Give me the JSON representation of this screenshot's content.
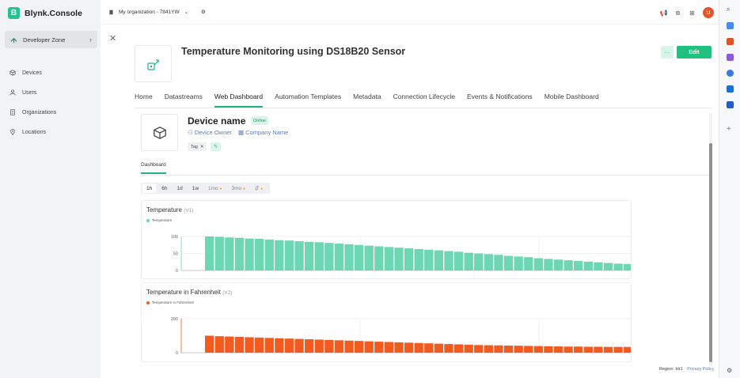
{
  "brand": {
    "name": "Blynk.Console",
    "logo_letter": "B"
  },
  "sidebar": {
    "developer_zone": "Developer Zone",
    "items": [
      {
        "label": "Devices",
        "icon": "cube-icon"
      },
      {
        "label": "Users",
        "icon": "users-icon"
      },
      {
        "label": "Organizations",
        "icon": "building-icon"
      },
      {
        "label": "Locations",
        "icon": "pin-icon"
      }
    ]
  },
  "topbar": {
    "organization": "My organization - 7841YW",
    "avatar_initial": "U"
  },
  "template": {
    "title": "Temperature Monitoring using DS18B20 Sensor",
    "more_label": "···",
    "edit_label": "Edit"
  },
  "tabs": [
    {
      "label": "Home"
    },
    {
      "label": "Datastreams"
    },
    {
      "label": "Web Dashboard",
      "active": true
    },
    {
      "label": "Automation Templates"
    },
    {
      "label": "Metadata"
    },
    {
      "label": "Connection Lifecycle"
    },
    {
      "label": "Events & Notifications"
    },
    {
      "label": "Mobile Dashboard"
    }
  ],
  "device": {
    "name": "Device name",
    "status": "Online",
    "owner": "Device Owner",
    "company": "Company Name",
    "tag": "Tag"
  },
  "dashboard_tab": "Dashboard",
  "time_ranges": [
    {
      "label": "1h",
      "active": true
    },
    {
      "label": "6h"
    },
    {
      "label": "1d"
    },
    {
      "label": "1w"
    },
    {
      "label": "1mo",
      "premium": true
    },
    {
      "label": "3mo",
      "premium": true
    },
    {
      "label": "⇵",
      "premium": true
    }
  ],
  "footer": {
    "region": "Region: blr1",
    "privacy": "Privacy Policy"
  },
  "colors": {
    "accent": "#20c17f",
    "temp_series": "#6dd6b2",
    "fahrenheit_series": "#f25a1e"
  },
  "chart_data": [
    {
      "type": "bar",
      "title": "Temperature",
      "pin": "(V1)",
      "series": [
        {
          "name": "Temperature",
          "values": [
            100,
            99,
            97,
            96,
            94,
            93,
            91,
            89,
            88,
            86,
            84,
            83,
            81,
            79,
            77,
            75,
            73,
            71,
            69,
            67,
            65,
            63,
            61,
            59,
            57,
            55,
            52,
            50,
            48,
            46,
            43,
            41,
            39,
            36,
            34,
            32,
            30,
            28,
            26,
            24,
            22,
            20,
            19,
            17,
            15,
            13,
            11,
            9,
            8,
            6,
            4,
            2
          ]
        }
      ],
      "ylim": [
        0,
        100
      ],
      "yticks": [
        0,
        50,
        100
      ],
      "grid": true
    },
    {
      "type": "bar",
      "title": "Temperature in Fahrenheit",
      "pin": "(V2)",
      "series": [
        {
          "name": "Temperature in Fahrenheit",
          "values": [
            100,
            97,
            95,
            93,
            91,
            89,
            87,
            85,
            83,
            81,
            79,
            77,
            75,
            73,
            71,
            69,
            67,
            65,
            63,
            61,
            59,
            57,
            55,
            53,
            51,
            49,
            47,
            45,
            44,
            43,
            42,
            41,
            40,
            39,
            38,
            37,
            36,
            36,
            35,
            35,
            34,
            34,
            34,
            33,
            33,
            33,
            33,
            33,
            33,
            33,
            33,
            33
          ]
        }
      ],
      "ylim": [
        0,
        200
      ],
      "yticks": [
        0,
        200
      ],
      "grid": true
    }
  ]
}
